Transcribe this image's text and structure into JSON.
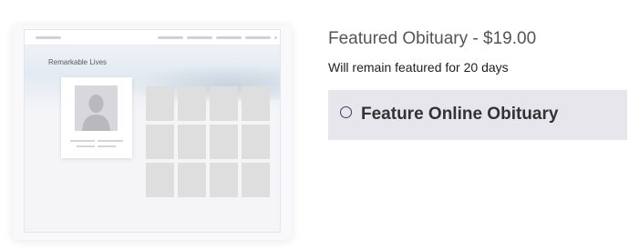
{
  "illustration": {
    "hero_label": "Remarkable Lives",
    "tile_count": 12
  },
  "product": {
    "title": "Featured Obituary - $19.00",
    "subtitle": "Will remain featured for 20 days"
  },
  "option": {
    "label": "Feature Online Obituary",
    "selected": false
  },
  "colors": {
    "option_background": "#e7e6ec",
    "radio_border": "#4a3a6a",
    "title_text": "#555555"
  }
}
